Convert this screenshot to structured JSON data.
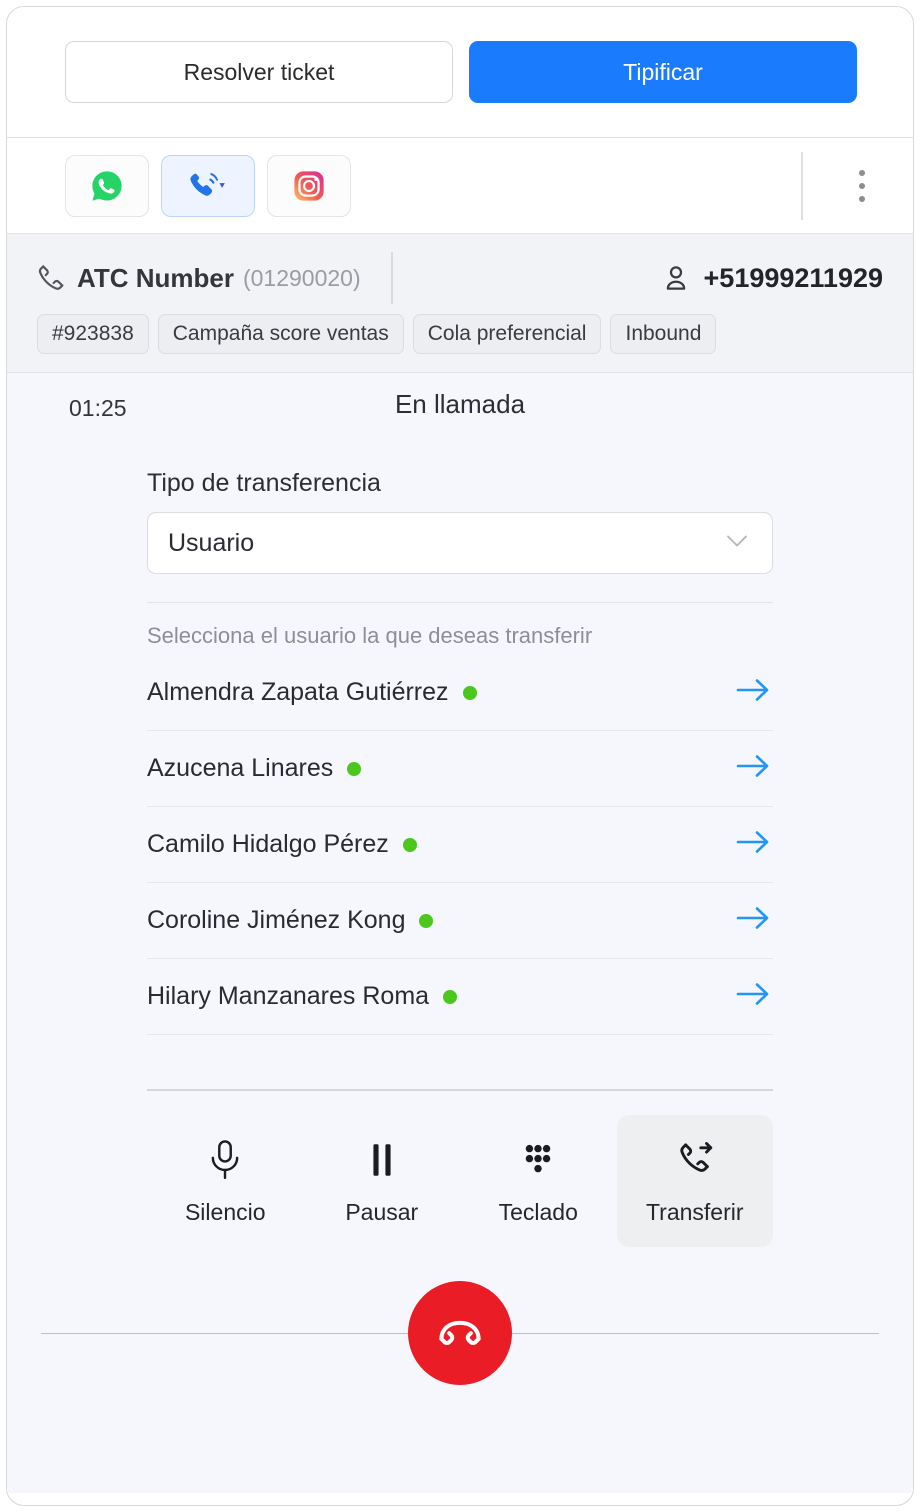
{
  "actions": {
    "resolve_label": "Resolver ticket",
    "tipificar_label": "Tipificar",
    "primary_color": "#1a7bfd"
  },
  "channels": {
    "items": [
      {
        "name": "whatsapp-channel",
        "icon": "whatsapp-icon",
        "active": false
      },
      {
        "name": "voice-channel",
        "icon": "phone-call-icon",
        "active": true
      },
      {
        "name": "instagram-channel",
        "icon": "instagram-icon",
        "active": false
      }
    ],
    "more_icon": "kebab-menu-icon"
  },
  "contact": {
    "line_icon": "phone-handset-icon",
    "line_name": "ATC Number",
    "line_id": "(01290020)",
    "person_icon": "person-icon",
    "phone": "+51999211929",
    "tags": [
      "#923838",
      "Campaña score ventas",
      "Cola preferencial",
      "Inbound"
    ]
  },
  "call": {
    "timer": "01:25",
    "status": "En llamada"
  },
  "transfer": {
    "type_label": "Tipo de transferencia",
    "type_value": "Usuario",
    "chevron_icon": "chevron-down-icon",
    "hint": "Selecciona el usuario la que deseas transferir",
    "status_color": "#4cc71e",
    "arrow_color": "#2196f3",
    "users": [
      {
        "name": "Almendra Zapata Gutiérrez",
        "status": "online"
      },
      {
        "name": "Azucena Linares",
        "status": "online"
      },
      {
        "name": "Camilo Hidalgo Pérez",
        "status": "online"
      },
      {
        "name": "Coroline Jiménez Kong",
        "status": "online"
      },
      {
        "name": "Hilary Manzanares Roma",
        "status": "online"
      }
    ]
  },
  "controls": {
    "items": [
      {
        "label": "Silencio",
        "icon": "microphone-icon",
        "active": false
      },
      {
        "label": "Pausar",
        "icon": "pause-icon",
        "active": false
      },
      {
        "label": "Teclado",
        "icon": "dialpad-icon",
        "active": false
      },
      {
        "label": "Transferir",
        "icon": "call-transfer-icon",
        "active": true
      }
    ],
    "hangup_icon": "hangup-icon",
    "hangup_color": "#ea1d26"
  }
}
